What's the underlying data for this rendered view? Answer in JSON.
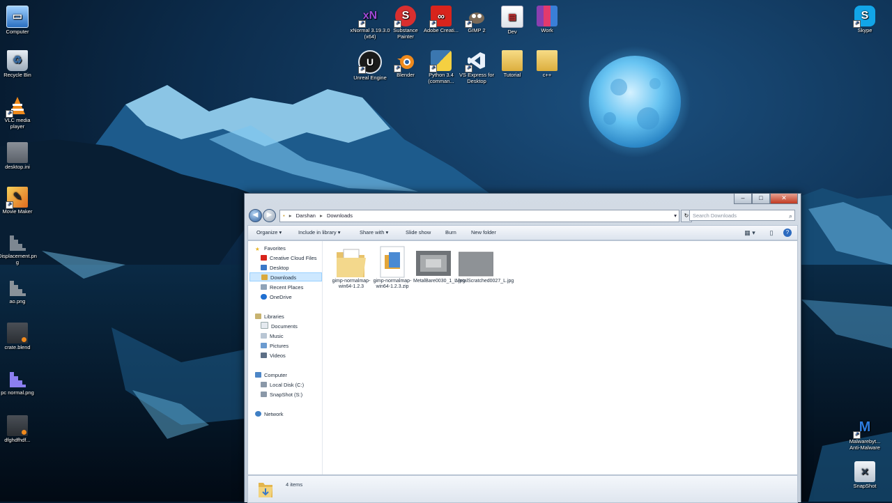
{
  "desktop": {
    "left_icons": [
      {
        "label": "Computer",
        "icon": "computer-icon"
      },
      {
        "label": "Recycle Bin",
        "icon": "recycle-bin-icon"
      },
      {
        "label": "VLC media player",
        "icon": "vlc-icon"
      },
      {
        "label": "desktop.ini",
        "icon": "file-icon"
      },
      {
        "label": "Movie Maker",
        "icon": "movie-maker-icon"
      },
      {
        "label": "Displacement.png",
        "icon": "image-file-icon"
      },
      {
        "label": "ao.png",
        "icon": "image-file-icon"
      },
      {
        "label": "crate.blend",
        "icon": "blend-file-icon"
      },
      {
        "label": "pc normal.png",
        "icon": "image-file-icon"
      },
      {
        "label": "dfghdfhdf...",
        "icon": "blend-file-icon"
      }
    ],
    "top_icons_row1": [
      {
        "label": "xNormal 3.19.3.0 (x64)",
        "icon": "xnormal-icon"
      },
      {
        "label": "Substance Painter",
        "icon": "substance-painter-icon"
      },
      {
        "label": "Adobe Creati...",
        "icon": "adobe-cc-icon"
      },
      {
        "label": "GIMP 2",
        "icon": "gimp-icon"
      },
      {
        "label": "Dev",
        "icon": "document-folder-icon"
      },
      {
        "label": "Work",
        "icon": "winrar-icon"
      }
    ],
    "top_icons_row2": [
      {
        "label": "Unreal Engine",
        "icon": "unreal-engine-icon"
      },
      {
        "label": "Blender",
        "icon": "blender-icon"
      },
      {
        "label": "Python 3.4 (comman...",
        "icon": "python-icon"
      },
      {
        "label": "VS Express for Desktop",
        "icon": "visual-studio-icon"
      },
      {
        "label": "Tutorial",
        "icon": "folder-icon"
      },
      {
        "label": "c++",
        "icon": "folder-icon"
      }
    ],
    "right_icons": [
      {
        "label": "Skype",
        "icon": "skype-icon"
      },
      {
        "label": "Malwarebyt... Anti-Malware",
        "icon": "malwarebytes-icon"
      },
      {
        "label": "SnapShot",
        "icon": "snapshot-icon"
      }
    ]
  },
  "explorer": {
    "window_buttons": {
      "minimize": "–",
      "maximize": "□",
      "close": "✕"
    },
    "breadcrumb": [
      "Darshan",
      "Downloads"
    ],
    "search_placeholder": "Search Downloads",
    "toolbar": {
      "organize": "Organize ▾",
      "include_in_library": "Include in library ▾",
      "share_with": "Share with ▾",
      "slide_show": "Slide show",
      "burn": "Burn",
      "new_folder": "New folder"
    },
    "nav": {
      "favorites": "Favorites",
      "favorites_items": [
        "Creative Cloud Files",
        "Desktop",
        "Downloads",
        "Recent Places",
        "OneDrive"
      ],
      "libraries": "Libraries",
      "libraries_items": [
        "Documents",
        "Music",
        "Pictures",
        "Videos"
      ],
      "computer": "Computer",
      "computer_items": [
        "Local Disk (C:)",
        "SnapShot (S:)"
      ],
      "network": "Network"
    },
    "files": [
      {
        "name": "gimp-normalmap-win64-1.2.3",
        "type": "folder"
      },
      {
        "name": "gimp-normalmap-win64-1.2.3.zip",
        "type": "zip"
      },
      {
        "name": "MetalBare0030_1_L.jpg",
        "type": "image"
      },
      {
        "name": "MetalScratched0027_L.jpg",
        "type": "image"
      }
    ],
    "status": "4 items",
    "colors": {
      "selection": "#cde8ff",
      "accent": "#2d6bbf"
    }
  }
}
